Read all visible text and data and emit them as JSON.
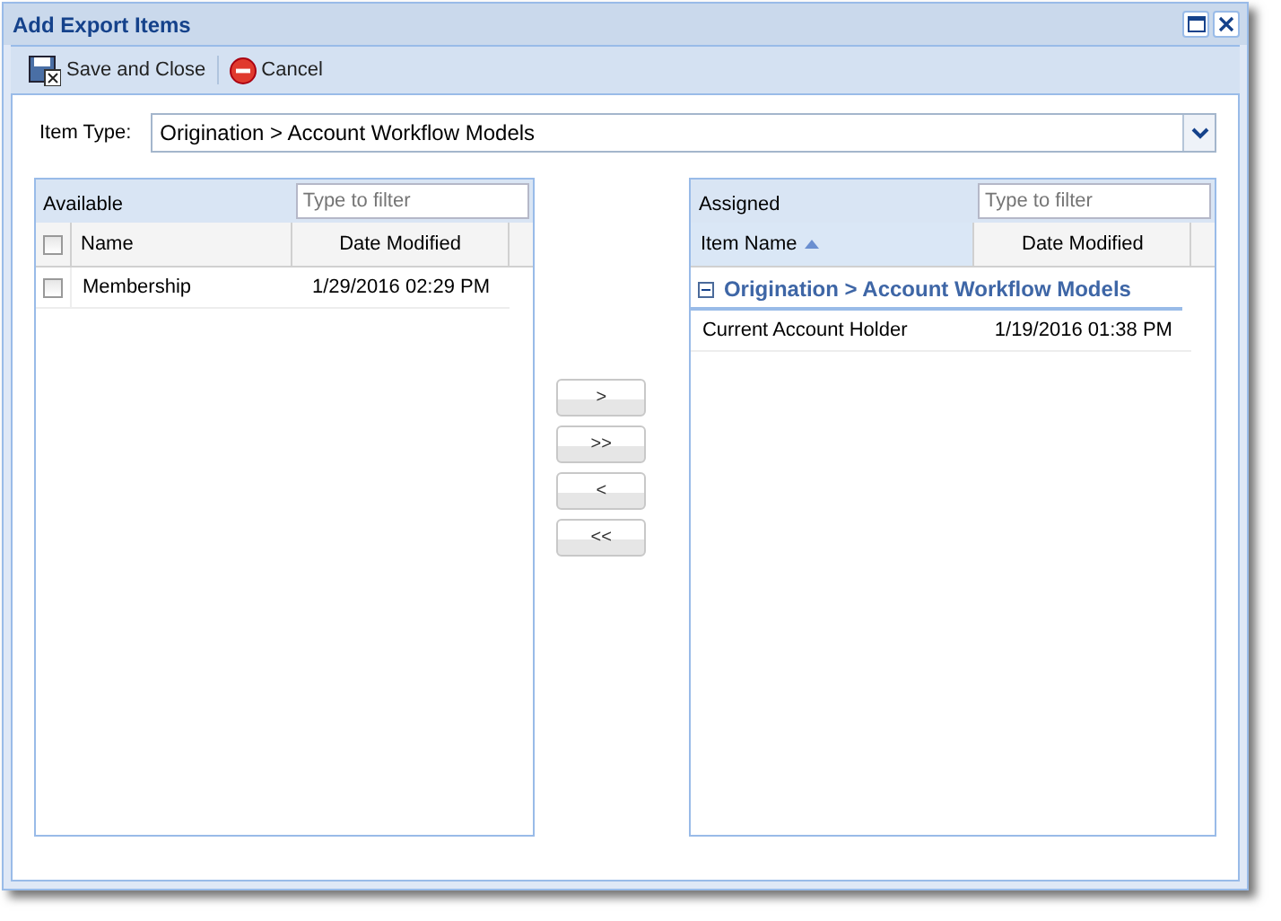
{
  "window": {
    "title": "Add Export Items"
  },
  "toolbar": [
    {
      "kind": "save",
      "label": "Save and Close"
    },
    {
      "kind": "cancel",
      "label": "Cancel"
    }
  ],
  "item_type": {
    "label": "Item Type:",
    "value": "Origination > Account Workflow Models"
  },
  "available": {
    "title": "Available",
    "filter_placeholder": "Type to filter",
    "all_checked": false,
    "columns": [
      "Name",
      "Date Modified"
    ],
    "rows": [
      {
        "checked": false,
        "cells": [
          "Membership",
          "1/29/2016 02:29 PM"
        ]
      }
    ]
  },
  "move_buttons": [
    ">",
    ">>",
    "<",
    "<<"
  ],
  "assigned": {
    "title": "Assigned",
    "filter_placeholder": "Type to filter",
    "columns": [
      {
        "label": "Item Name",
        "sorted": true
      },
      {
        "label": "Date Modified",
        "sorted": false
      }
    ],
    "groups": [
      {
        "label": "Origination > Account Workflow Models",
        "expanded": true,
        "rows": [
          {
            "cells": [
              "Current Account Holder",
              "1/19/2016 01:38 PM"
            ]
          }
        ]
      }
    ]
  }
}
